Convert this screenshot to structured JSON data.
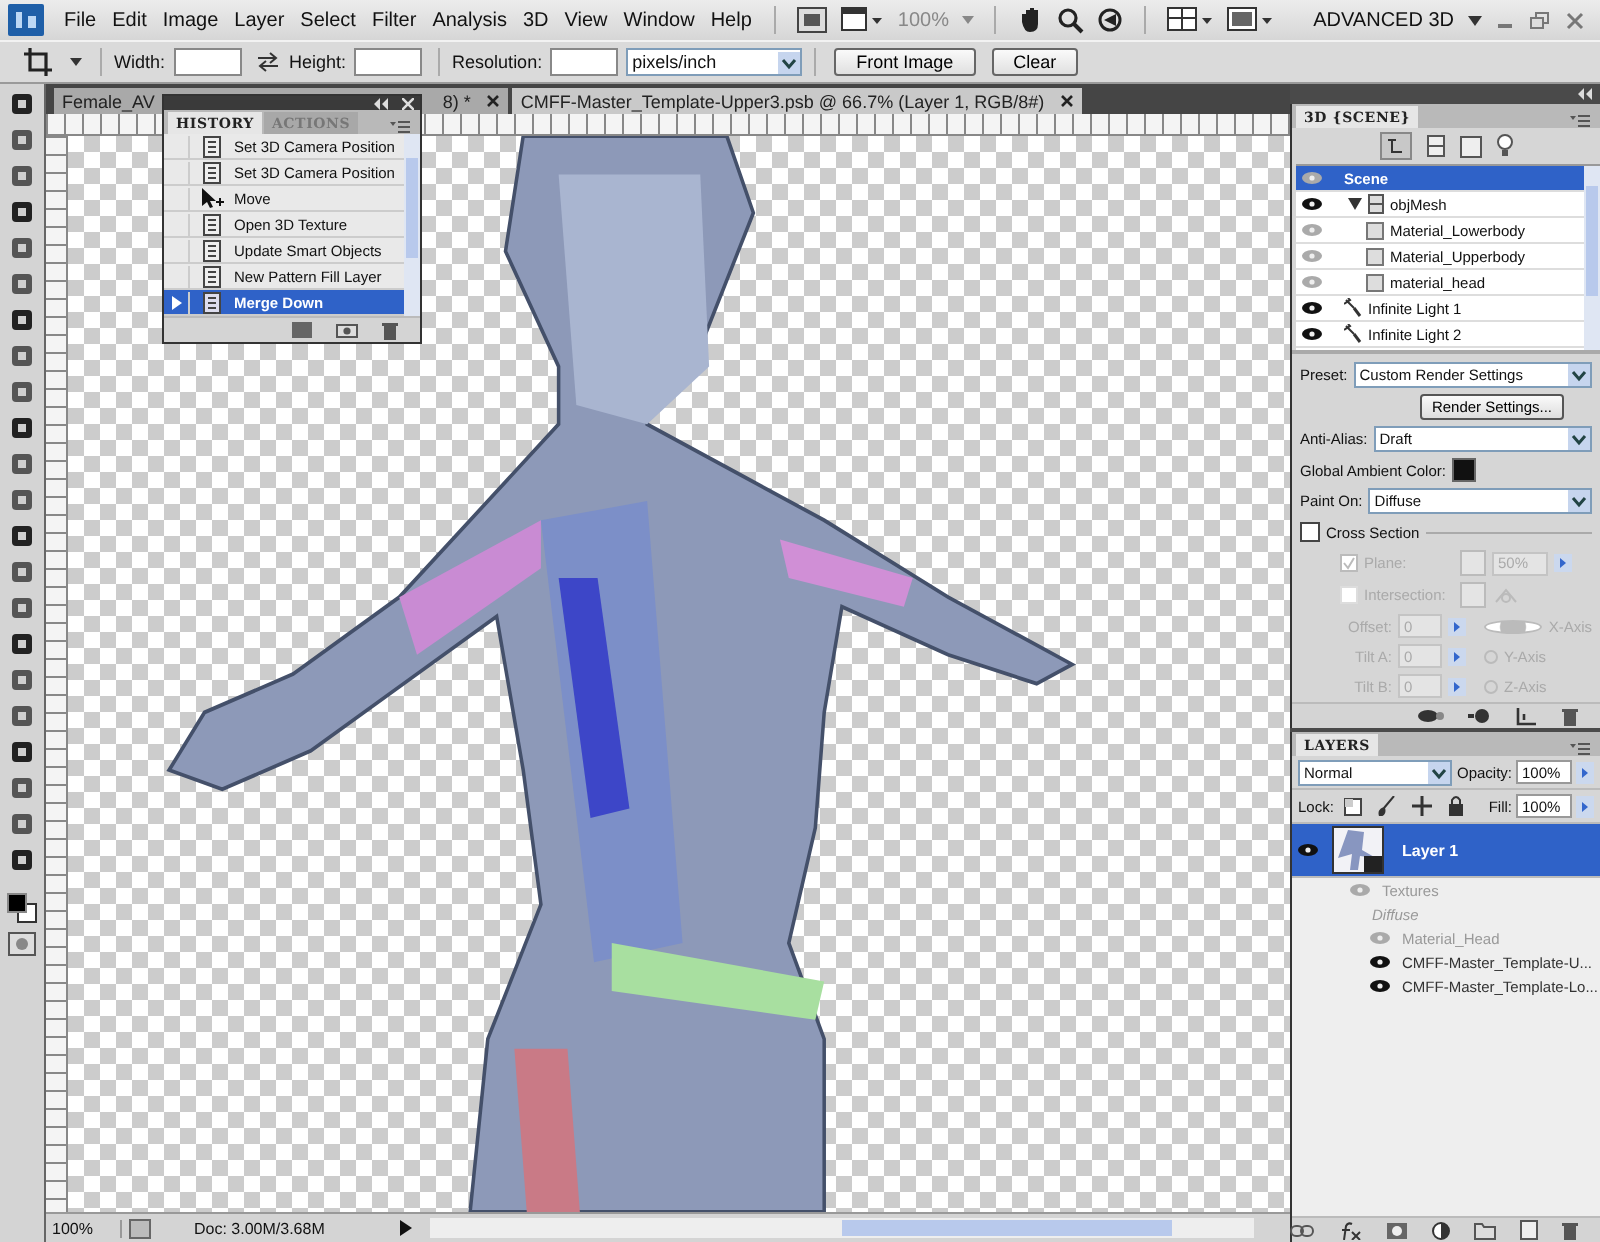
{
  "menu_bar": {
    "items": [
      "File",
      "Edit",
      "Image",
      "Layer",
      "Select",
      "Filter",
      "Analysis",
      "3D",
      "View",
      "Window",
      "Help"
    ],
    "zoom": "100%",
    "workspace": "ADVANCED 3D"
  },
  "options_bar": {
    "width_label": "Width:",
    "height_label": "Height:",
    "resolution_label": "Resolution:",
    "units": "pixels/inch",
    "buttons": [
      "Front Image",
      "Clear"
    ]
  },
  "document_tabs": [
    {
      "label": "Female_AV",
      "label_end": "8) *",
      "selected": false
    },
    {
      "label": "CMFF-Master_Template-Upper3.psb @ 66.7% (Layer 1, RGB/8#)",
      "selected": true
    }
  ],
  "history_panel": {
    "tabs": [
      {
        "label": "HISTORY",
        "selected": true
      },
      {
        "label": "ACTIONS",
        "selected": false
      }
    ],
    "items": [
      {
        "label": "Set 3D Camera Position",
        "kind": "state",
        "selected": false
      },
      {
        "label": "Set 3D Camera Position",
        "kind": "state",
        "selected": false
      },
      {
        "label": "Move",
        "kind": "move",
        "selected": false
      },
      {
        "label": "Open 3D Texture",
        "kind": "state",
        "selected": false
      },
      {
        "label": "Update Smart Objects",
        "kind": "state",
        "selected": false
      },
      {
        "label": "New Pattern Fill Layer",
        "kind": "state",
        "selected": false
      },
      {
        "label": "Merge Down",
        "kind": "state",
        "selected": true
      }
    ]
  },
  "scene_panel": {
    "title": "3D {SCENE}",
    "tree": [
      {
        "label": "Scene",
        "kind": "scene",
        "visible": false,
        "selected": true
      },
      {
        "label": "objMesh",
        "kind": "mesh",
        "visible": true,
        "selected": false,
        "expanded": true,
        "children": [
          {
            "label": "Material_Lowerbody",
            "visible": false
          },
          {
            "label": "Material_Upperbody",
            "visible": false
          },
          {
            "label": "material_head",
            "visible": false
          }
        ]
      },
      {
        "label": "Infinite Light 1",
        "kind": "light",
        "visible": true,
        "selected": false
      },
      {
        "label": "Infinite Light 2",
        "kind": "light",
        "visible": true,
        "selected": false
      }
    ],
    "preset_label": "Preset:",
    "preset": "Custom Render Settings",
    "render_button": "Render Settings...",
    "anti_alias_label": "Anti-Alias:",
    "anti_alias": "Draft",
    "ambient_label": "Global Ambient Color:",
    "paint_on_label": "Paint On:",
    "paint_on": "Diffuse",
    "cross_section": {
      "label": "Cross Section",
      "checked": false,
      "plane_label": "Plane:",
      "plane_checked": true,
      "plane_value": "50%",
      "intersection_label": "Intersection:",
      "intersection_checked": false,
      "rows": [
        {
          "label": "Offset:",
          "value": "0",
          "axis": "X-Axis",
          "selected": true
        },
        {
          "label": "Tilt A:",
          "value": "0",
          "axis": "Y-Axis",
          "selected": false
        },
        {
          "label": "Tilt B:",
          "value": "0",
          "axis": "Z-Axis",
          "selected": false
        }
      ]
    }
  },
  "layers_panel": {
    "title": "LAYERS",
    "blend_mode": "Normal",
    "opacity_label": "Opacity:",
    "opacity": "100%",
    "lock_label": "Lock:",
    "fill_label": "Fill:",
    "fill": "100%",
    "items": [
      {
        "kind": "layer",
        "label": "Layer 1",
        "selected": true
      },
      {
        "kind": "group",
        "label": "Textures",
        "visible": false
      },
      {
        "kind": "type",
        "label": "Diffuse"
      },
      {
        "kind": "texture",
        "label": "Material_Head",
        "visible": false
      },
      {
        "kind": "texture",
        "label": "CMFF-Master_Template-U...",
        "visible": true
      },
      {
        "kind": "texture",
        "label": "CMFF-Master_Template-Lo...",
        "visible": true
      }
    ]
  },
  "status_bar": {
    "zoom": "100%",
    "doc": "Doc: 3.00M/3.68M"
  }
}
